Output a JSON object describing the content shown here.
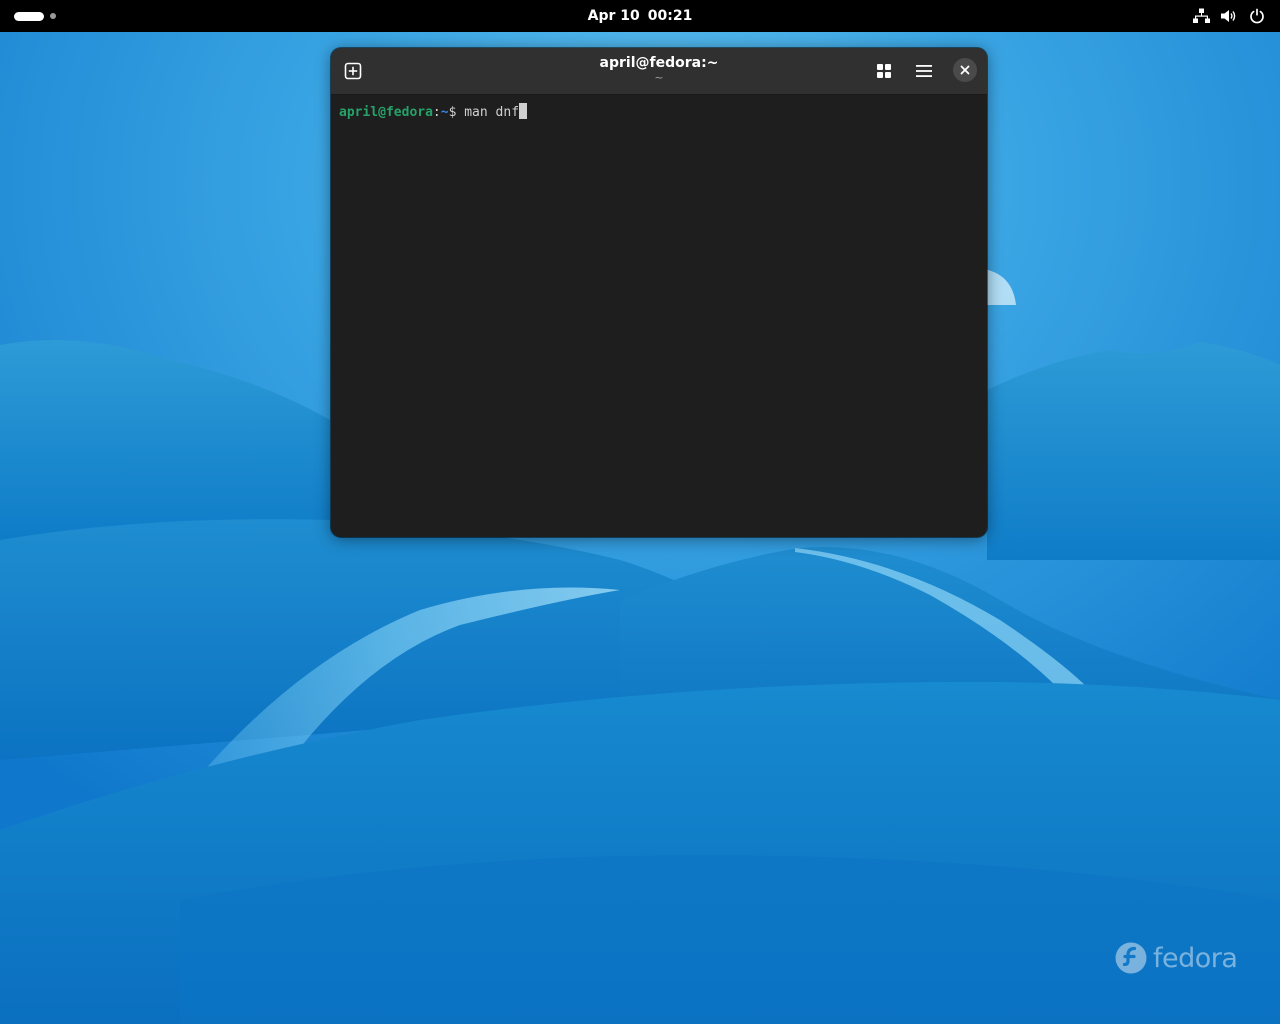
{
  "topbar": {
    "date": "Apr 10",
    "time": "00:21",
    "tray_icons": [
      "network-icon",
      "volume-icon",
      "power-icon"
    ]
  },
  "window": {
    "title": "april@fedora:~",
    "subtitle": "~"
  },
  "terminal": {
    "prompt_user": "april@fedora",
    "prompt_sep": ":",
    "prompt_path": "~",
    "prompt_symbol": "$ ",
    "command": "man dnf"
  },
  "desktop": {
    "watermark": "fedora"
  },
  "colors": {
    "topbar_bg": "#000000",
    "window_bg": "#1e1e1e",
    "headerbar_bg": "#303030",
    "prompt_user": "#26a269",
    "prompt_path": "#3584e4",
    "wallpaper_base": "#1a7fce"
  }
}
